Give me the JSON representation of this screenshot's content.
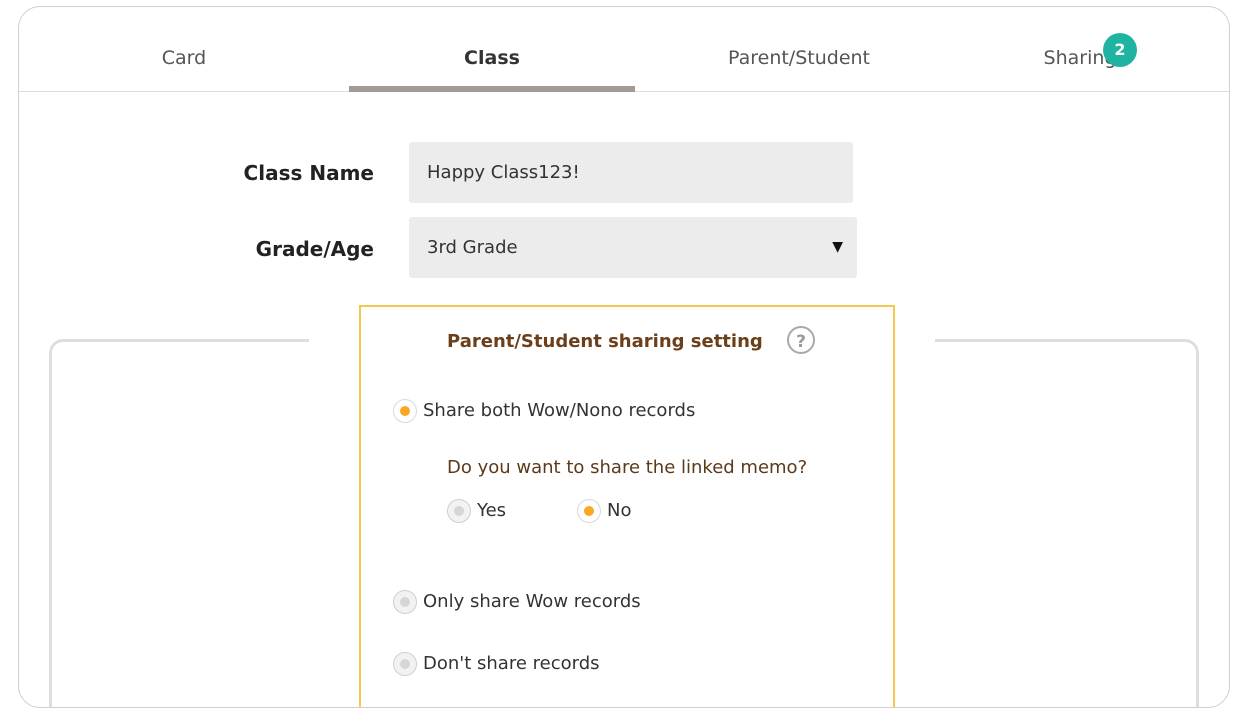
{
  "tabs": [
    {
      "label": "Card",
      "active": false
    },
    {
      "label": "Class",
      "active": true
    },
    {
      "label": "Parent/Student",
      "active": false
    },
    {
      "label": "Sharing",
      "active": false,
      "badge": "2"
    }
  ],
  "form": {
    "class_name_label": "Class Name",
    "class_name_value": "Happy Class123!",
    "grade_label": "Grade/Age",
    "grade_value": "3rd Grade"
  },
  "sharing": {
    "title": "Parent/Student sharing setting",
    "help_icon": "?",
    "options": [
      {
        "label": "Share both Wow/Nono records",
        "selected": true
      },
      {
        "label": "Only share Wow records",
        "selected": false
      },
      {
        "label": "Don't share records",
        "selected": false
      }
    ],
    "memo_question": "Do you want to share the linked memo?",
    "memo_options": [
      {
        "label": "Yes",
        "selected": false
      },
      {
        "label": "No",
        "selected": true
      }
    ]
  },
  "colors": {
    "accent": "#f7a824",
    "badge": "#1fb4a1",
    "panel_border": "#f4c84a",
    "tab_underline": "#a29a94"
  }
}
